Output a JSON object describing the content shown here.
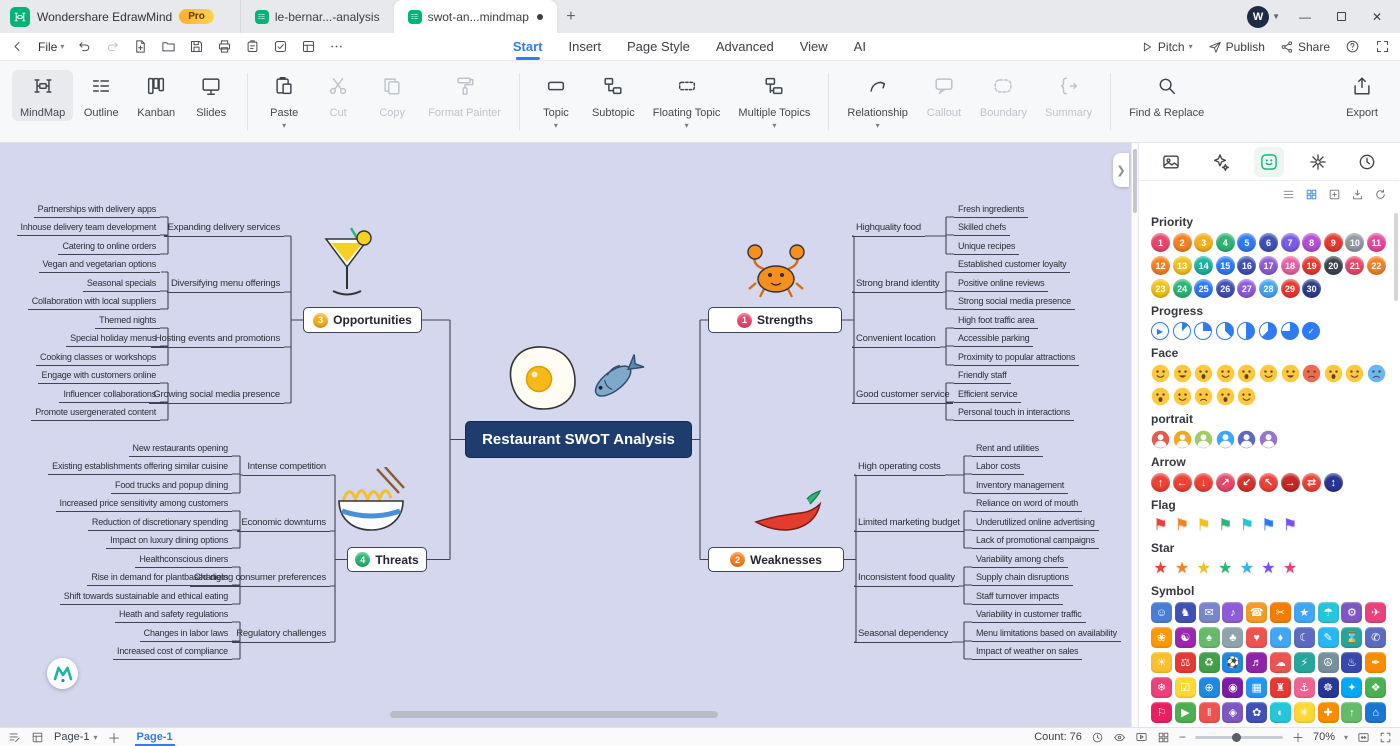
{
  "colors": {
    "accent_blue": "#2f7df0",
    "edraw_green": "#00b478",
    "canvas_bg": "#d4d7ee",
    "central_topic_bg": "#1e3c6e",
    "connector": "#3e4452",
    "pro_badge": "#ffb02e"
  },
  "titlebar": {
    "app_name": "Wondershare EdrawMind",
    "pro_badge": "Pro",
    "doc_tabs": [
      {
        "label": "le-bernar...-analysis",
        "active": false,
        "unsaved": false
      },
      {
        "label": "swot-an...mindmap",
        "active": true,
        "unsaved": true
      }
    ],
    "avatar_letter": "W"
  },
  "menubar": {
    "file_label": "File",
    "tabs": [
      {
        "label": "Start",
        "active": true
      },
      {
        "label": "Insert",
        "active": false
      },
      {
        "label": "Page Style",
        "active": false
      },
      {
        "label": "Advanced",
        "active": false
      },
      {
        "label": "View",
        "active": false
      },
      {
        "label": "AI",
        "active": false
      }
    ],
    "pitch_label": "Pitch",
    "publish_label": "Publish",
    "share_label": "Share"
  },
  "ribbon": {
    "modes": [
      {
        "label": "MindMap",
        "icon": "mindmap",
        "active": true
      },
      {
        "label": "Outline",
        "icon": "outline",
        "active": false
      },
      {
        "label": "Kanban",
        "icon": "kanban",
        "active": false
      },
      {
        "label": "Slides",
        "icon": "slides",
        "active": false
      }
    ],
    "clipboard": [
      {
        "label": "Paste",
        "icon": "paste",
        "enabled": true,
        "dropdown": true
      },
      {
        "label": "Cut",
        "icon": "cut",
        "enabled": false,
        "dropdown": false
      },
      {
        "label": "Copy",
        "icon": "copy",
        "enabled": false,
        "dropdown": false
      },
      {
        "label": "Format Painter",
        "icon": "painter",
        "enabled": false,
        "dropdown": false
      }
    ],
    "topics": [
      {
        "label": "Topic",
        "icon": "topic",
        "enabled": true,
        "dropdown": true
      },
      {
        "label": "Subtopic",
        "icon": "subtopic",
        "enabled": true,
        "dropdown": false
      },
      {
        "label": "Floating Topic",
        "icon": "floating",
        "enabled": true,
        "dropdown": true
      },
      {
        "label": "Multiple Topics",
        "icon": "multiple",
        "enabled": true,
        "dropdown": true
      }
    ],
    "relations": [
      {
        "label": "Relationship",
        "icon": "relationship",
        "enabled": true,
        "dropdown": true
      },
      {
        "label": "Callout",
        "icon": "callout",
        "enabled": false,
        "dropdown": false
      },
      {
        "label": "Boundary",
        "icon": "boundary",
        "enabled": false,
        "dropdown": false
      },
      {
        "label": "Summary",
        "icon": "summary",
        "enabled": false,
        "dropdown": false
      }
    ],
    "find": {
      "label": "Find & Replace",
      "icon": "find",
      "enabled": true,
      "dropdown": false
    },
    "export": {
      "label": "Export",
      "icon": "export",
      "enabled": true,
      "dropdown": false
    }
  },
  "mindmap": {
    "central": "Restaurant SWOT Analysis",
    "images": [
      "cocktail",
      "crab",
      "fried-egg",
      "fish",
      "noodles",
      "chili"
    ],
    "branches": [
      {
        "label": "Opportunities",
        "num": "3",
        "num_color": "#f5af1b",
        "children": [
          {
            "label": "Expanding delivery services",
            "leaves": [
              "Partnerships with delivery apps",
              "Inhouse delivery team development",
              "Catering to online orders"
            ]
          },
          {
            "label": "Diversifying menu offerings",
            "leaves": [
              "Vegan and vegetarian options",
              "Seasonal specials",
              "Collaboration with local suppliers"
            ]
          },
          {
            "label": "Hosting events and promotions",
            "leaves": [
              "Themed nights",
              "Special holiday menus",
              "Cooking classes or workshops"
            ]
          },
          {
            "label": "Growing social media presence",
            "leaves": [
              "Engage with customers online",
              "Influencer collaborations",
              "Promote usergenerated content"
            ]
          }
        ]
      },
      {
        "label": "Strengths",
        "num": "1",
        "num_color": "#e8476b",
        "children": [
          {
            "label": "Highquality food",
            "leaves": [
              "Fresh ingredients",
              "Skilled chefs",
              "Unique recipes"
            ]
          },
          {
            "label": "Strong brand identity",
            "leaves": [
              "Established customer loyalty",
              "Positive online reviews",
              "Strong social media presence"
            ]
          },
          {
            "label": "Convenient location",
            "leaves": [
              "High foot traffic area",
              "Accessible parking",
              "Proximity to popular attractions"
            ]
          },
          {
            "label": "Good customer service",
            "leaves": [
              "Friendly staff",
              "Efficient service",
              "Personal touch in interactions"
            ]
          }
        ]
      },
      {
        "label": "Threats",
        "num": "4",
        "num_color": "#2bb673",
        "children": [
          {
            "label": "Intense competition",
            "leaves": [
              "New restaurants opening",
              "Existing establishments offering similar cuisine",
              "Food trucks and popup dining"
            ]
          },
          {
            "label": "Economic downturns",
            "leaves": [
              "Increased price sensitivity among customers",
              "Reduction of discretionary spending",
              "Impact on luxury dining options"
            ]
          },
          {
            "label": "Changing consumer preferences",
            "leaves": [
              "Healthconscious diners",
              "Rise in demand for plantbased diets",
              "Shift towards sustainable and ethical eating"
            ]
          },
          {
            "label": "Regulatory challenges",
            "leaves": [
              "Heath and safety regulations",
              "Changes in labor laws",
              "Increased cost of compliance"
            ]
          }
        ]
      },
      {
        "label": "Weaknesses",
        "num": "2",
        "num_color": "#f58220",
        "children": [
          {
            "label": "High operating costs",
            "leaves": [
              "Rent and utilities",
              "Labor costs",
              "Inventory management"
            ]
          },
          {
            "label": "Limited marketing budget",
            "leaves": [
              "Reliance on word of mouth",
              "Underutilized online advertising",
              "Lack of promotional campaigns"
            ]
          },
          {
            "label": "Inconsistent food quality",
            "leaves": [
              "Variability among chefs",
              "Supply chain disruptions",
              "Staff turnover impacts"
            ]
          },
          {
            "label": "Seasonal dependency",
            "leaves": [
              "Variability in customer traffic",
              "Menu limitations based on availability",
              "Impact of weather on sales"
            ]
          }
        ]
      }
    ]
  },
  "panel": {
    "tabs": [
      {
        "name": "clipart",
        "icon": "image",
        "active": false
      },
      {
        "name": "ai-image",
        "icon": "sparkle",
        "active": false
      },
      {
        "name": "sticker",
        "icon": "sticker",
        "active": true
      },
      {
        "name": "decoration",
        "icon": "flower",
        "active": false
      },
      {
        "name": "recent",
        "icon": "clock",
        "active": false
      }
    ],
    "toolbar": [
      {
        "name": "list-view",
        "icon": "list",
        "active": false
      },
      {
        "name": "grid-view",
        "icon": "gridsm",
        "active": true
      },
      {
        "name": "insert",
        "icon": "insert",
        "active": false
      },
      {
        "name": "download",
        "icon": "download",
        "active": false
      },
      {
        "name": "refresh",
        "icon": "refresh",
        "active": false
      }
    ],
    "sections": [
      {
        "title": "Priority",
        "type": "priority",
        "colors": [
          "#e8476b",
          "#f58220",
          "#f5af1b",
          "#2bb673",
          "#2f7bf5",
          "#3f51b5",
          "#7b5be8",
          "#b44fd8",
          "#e8382f",
          "#939aa3",
          "#e8479b",
          "#f58220",
          "#f2c21a",
          "#18b5a0",
          "#2f7bf5",
          "#3f51b5",
          "#8e5cd9",
          "#ec5fa1",
          "#e8382f",
          "#3b4450",
          "#e8476b",
          "#f58220",
          "#f2c21a",
          "#2bb673",
          "#2f7bf5",
          "#3f51b5",
          "#8e5cd9",
          "#4aa3f0",
          "#e8382f",
          "#2c3e8c"
        ]
      },
      {
        "title": "Progress",
        "type": "progress",
        "items": [
          "play",
          0.125,
          0.25,
          0.375,
          0.5,
          0.625,
          0.75,
          "check"
        ]
      },
      {
        "title": "Face",
        "type": "face",
        "items": [
          {
            "c": "#ffc83d",
            "m": "smile"
          },
          {
            "c": "#ffc83d",
            "m": "grin"
          },
          {
            "c": "#ffc83d",
            "m": "open"
          },
          {
            "c": "#ffc83d",
            "m": "smile"
          },
          {
            "c": "#ffc83d",
            "m": "open"
          },
          {
            "c": "#ffc83d",
            "m": "smile"
          },
          {
            "c": "#ffc83d",
            "m": "grin"
          },
          {
            "c": "#f06a4d",
            "m": "frown"
          },
          {
            "c": "#ffc83d",
            "m": "open"
          },
          {
            "c": "#ffc83d",
            "m": "smile"
          },
          {
            "c": "#6ab7f5",
            "m": "frown"
          },
          {
            "c": "#ffc83d",
            "m": "open"
          },
          {
            "c": "#ffc83d",
            "m": "smile"
          },
          {
            "c": "#ffc83d",
            "m": "frown"
          },
          {
            "c": "#ffc83d",
            "m": "open"
          },
          {
            "c": "#ffc83d",
            "m": "smile"
          }
        ]
      },
      {
        "title": "portrait",
        "type": "portrait",
        "colors": [
          "#e8584a",
          "#f5a623",
          "#9ccc65",
          "#42a5f5",
          "#5c6bc0",
          "#9575cd"
        ]
      },
      {
        "title": "Arrow",
        "type": "arrow",
        "items": [
          {
            "c": "#ef4136",
            "g": "↑"
          },
          {
            "c": "#ef4136",
            "g": "←"
          },
          {
            "c": "#ef4136",
            "g": "↓"
          },
          {
            "c": "#e8476b",
            "g": "↗"
          },
          {
            "c": "#d8322b",
            "g": "↙"
          },
          {
            "c": "#ef4136",
            "g": "↖"
          },
          {
            "c": "#c62828",
            "g": "→"
          },
          {
            "c": "#ef4136",
            "g": "⇄"
          },
          {
            "c": "#283593",
            "g": "↕"
          }
        ]
      },
      {
        "title": "Flag",
        "type": "flag",
        "colors": [
          "#ef4136",
          "#f58220",
          "#f2c21a",
          "#2bb673",
          "#26c6da",
          "#2979ff",
          "#7c4dff"
        ]
      },
      {
        "title": "Star",
        "type": "star",
        "colors": [
          "#ef4136",
          "#f58220",
          "#f2c21a",
          "#2bb673",
          "#29b6f6",
          "#7c4dff",
          "#ec407a"
        ]
      },
      {
        "title": "Symbol",
        "type": "symbol",
        "items": [
          [
            "#4a7dd6",
            "☺"
          ],
          [
            "#3f51b5",
            "♞"
          ],
          [
            "#7986cb",
            "✉"
          ],
          [
            "#8e5cd9",
            "♪"
          ],
          [
            "#f59a23",
            "☎"
          ],
          [
            "#f57c00",
            "✂"
          ],
          [
            "#42a5f5",
            "★"
          ],
          [
            "#26c6da",
            "☂"
          ],
          [
            "#7e57c2",
            "⚙"
          ],
          [
            "#ec407a",
            "✈"
          ],
          [
            "#ff9800",
            "❀"
          ],
          [
            "#9c27b0",
            "☯"
          ],
          [
            "#66bb6a",
            "♠"
          ],
          [
            "#90a4ae",
            "♣"
          ],
          [
            "#ef5350",
            "♥"
          ],
          [
            "#42a5f5",
            "♦"
          ],
          [
            "#5c6bc0",
            "☾"
          ],
          [
            "#29b6f6",
            "✎"
          ],
          [
            "#26a69a",
            "⌛"
          ],
          [
            "#5c6bc0",
            "✆"
          ],
          [
            "#fbc02d",
            "☀"
          ],
          [
            "#e53935",
            "⚖"
          ],
          [
            "#43a047",
            "♻"
          ],
          [
            "#1e88e5",
            "⚽"
          ],
          [
            "#8e24aa",
            "♬"
          ],
          [
            "#ef5350",
            "☁"
          ],
          [
            "#26a69a",
            "⚡"
          ],
          [
            "#78909c",
            "☮"
          ],
          [
            "#3949ab",
            "♨"
          ],
          [
            "#fb8c00",
            "✒"
          ],
          [
            "#ec407a",
            "❄"
          ],
          [
            "#fdd835",
            "☑"
          ],
          [
            "#1e88e5",
            "⊕"
          ],
          [
            "#7b1fa2",
            "◉"
          ],
          [
            "#2196f3",
            "▦"
          ],
          [
            "#e53935",
            "♜"
          ],
          [
            "#f06292",
            "⚓"
          ],
          [
            "#283593",
            "☸"
          ],
          [
            "#03a9f4",
            "✦"
          ],
          [
            "#4caf50",
            "❖"
          ],
          [
            "#e91e63",
            "⚐"
          ],
          [
            "#4caf50",
            "▶"
          ],
          [
            "#ef5350",
            "‖"
          ],
          [
            "#7e57c2",
            "◈"
          ],
          [
            "#3f51b5",
            "✿"
          ],
          [
            "#26c6da",
            "◐"
          ],
          [
            "#fdd835",
            "✳"
          ],
          [
            "#fb8c00",
            "✚"
          ],
          [
            "#66bb6a",
            "↑"
          ],
          [
            "#1976d2",
            "⌂"
          ]
        ]
      }
    ]
  },
  "statusbar": {
    "page_selector": "Page-1",
    "page_tab": "Page-1",
    "count_label": "Count: 76",
    "zoom_label": "70%"
  }
}
